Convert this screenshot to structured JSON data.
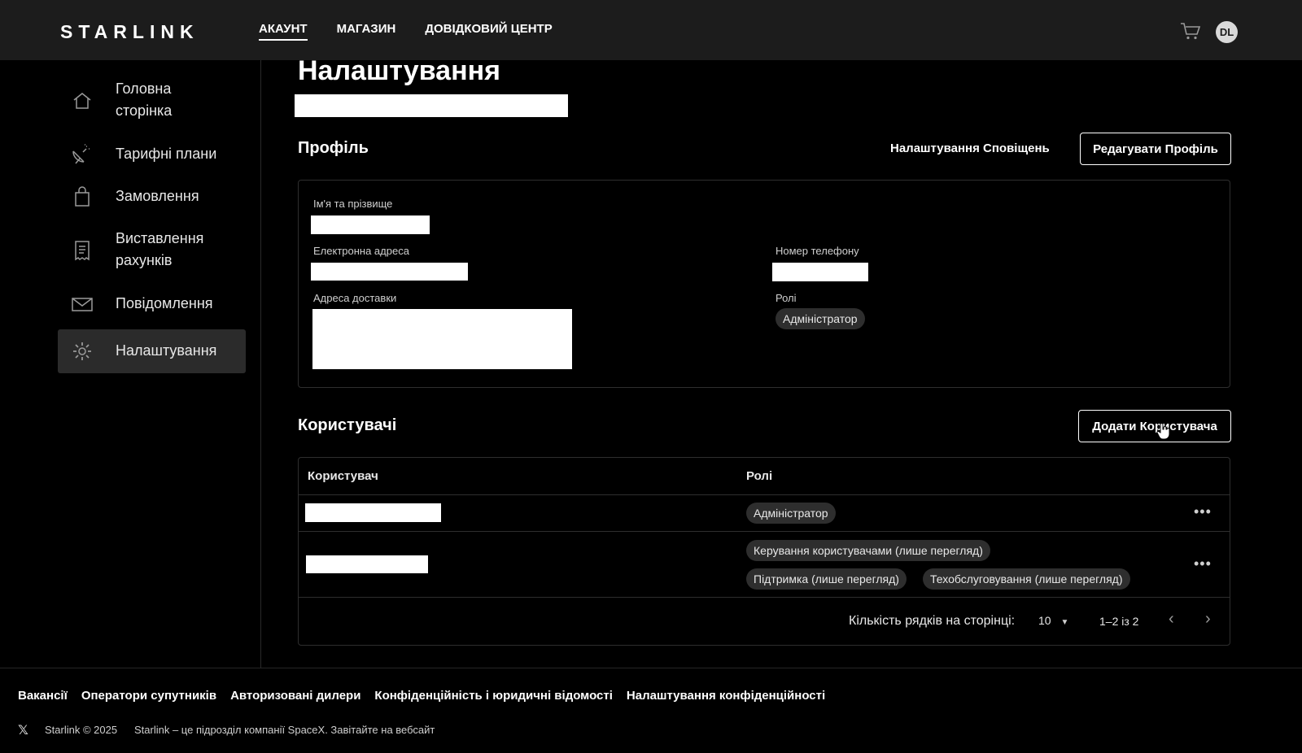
{
  "header": {
    "logo": "STARLINK",
    "nav": [
      {
        "label": "АКАУНТ",
        "active": true
      },
      {
        "label": "МАГАЗИН",
        "active": false
      },
      {
        "label": "ДОВІДКОВИЙ ЦЕНТР",
        "active": false
      }
    ],
    "avatar_initials": "DL",
    "cart_icon": "cart-icon"
  },
  "sidebar": {
    "items": [
      {
        "label": "Головна\nсторінка",
        "icon": "home-icon",
        "active": false
      },
      {
        "label": "Тарифні плани",
        "icon": "satellite-dish-icon",
        "active": false
      },
      {
        "label": "Замовлення",
        "icon": "shopping-bag-icon",
        "active": false
      },
      {
        "label": "Виставлення\nрахунків",
        "icon": "receipt-icon",
        "active": false
      },
      {
        "label": "Повідомлення",
        "icon": "envelope-icon",
        "active": false
      },
      {
        "label": "Налаштування",
        "icon": "gear-icon",
        "active": true
      }
    ]
  },
  "main": {
    "title": "Налаштування",
    "profile": {
      "title": "Профіль",
      "notifications_link": "Налаштування Сповіщень",
      "edit_button": "Редагувати Профіль",
      "fields": {
        "name_label": "Ім'я та прізвище",
        "email_label": "Електронна адреса",
        "address_label": "Адреса доставки",
        "phone_label": "Номер телефону",
        "roles_label": "Ролі",
        "role_chip": "Адміністратор"
      }
    },
    "users": {
      "title": "Користувачі",
      "add_button": "Додати Користувача",
      "columns": [
        "Користувач",
        "Ролі"
      ],
      "rows": [
        {
          "roles": [
            "Адміністратор"
          ]
        },
        {
          "roles": [
            "Керування користувачами (лише перегляд)",
            "Підтримка (лише перегляд)",
            "Техобслуговування (лише перегляд)"
          ]
        }
      ],
      "row_menu": "•••",
      "pagination": {
        "rows_per_page_label": "Кількість рядків на сторінці:",
        "rows_per_page_value": "10",
        "range": "1–2 із 2"
      }
    }
  },
  "footer": {
    "links": [
      "Вакансії",
      "Оператори супутників",
      "Авторизовані дилери",
      "Конфіденційність і юридичні відомості",
      "Налаштування конфіденційності"
    ],
    "copyright": "Starlink © 2025",
    "tagline": "Starlink – це підрозділ компанії SpaceX. Завітайте на вебсайт",
    "social_icon": "x-logo-icon"
  }
}
